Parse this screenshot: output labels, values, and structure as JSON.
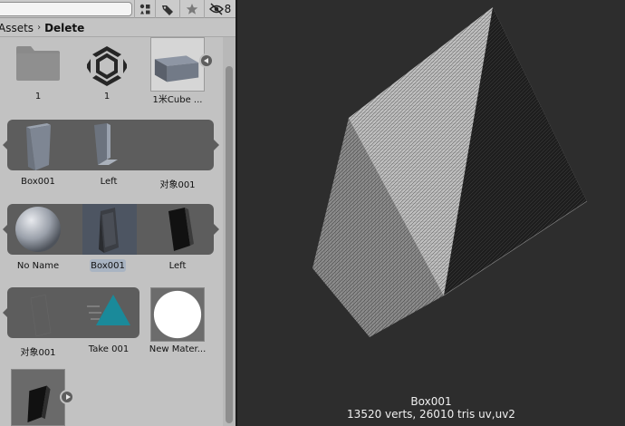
{
  "toolbar": {
    "search_placeholder": "",
    "hidden_packages_count": "8"
  },
  "breadcrumb": {
    "root": "Assets",
    "separator": "›",
    "current": "Delete"
  },
  "assets": [
    {
      "label": "1"
    },
    {
      "label": "1"
    },
    {
      "label": "1米Cube ..."
    },
    {
      "label": "Box001"
    },
    {
      "label": "Left"
    },
    {
      "label": "对象001"
    },
    {
      "label": "No Name"
    },
    {
      "label": "Box001"
    },
    {
      "label": "Left"
    },
    {
      "label": "对象001"
    },
    {
      "label": "Take 001"
    },
    {
      "label": "New Mater..."
    }
  ],
  "preview": {
    "name": "Box001",
    "stats": "13520 verts, 26010 tris   uv,uv2"
  },
  "colors": {
    "panel_bg": "#c2c2c2",
    "preview_bg": "#2d2d2d",
    "group_band": "#5d5d5d",
    "selection": "#a9b4c2",
    "unity_teal": "#1a8a9a"
  }
}
